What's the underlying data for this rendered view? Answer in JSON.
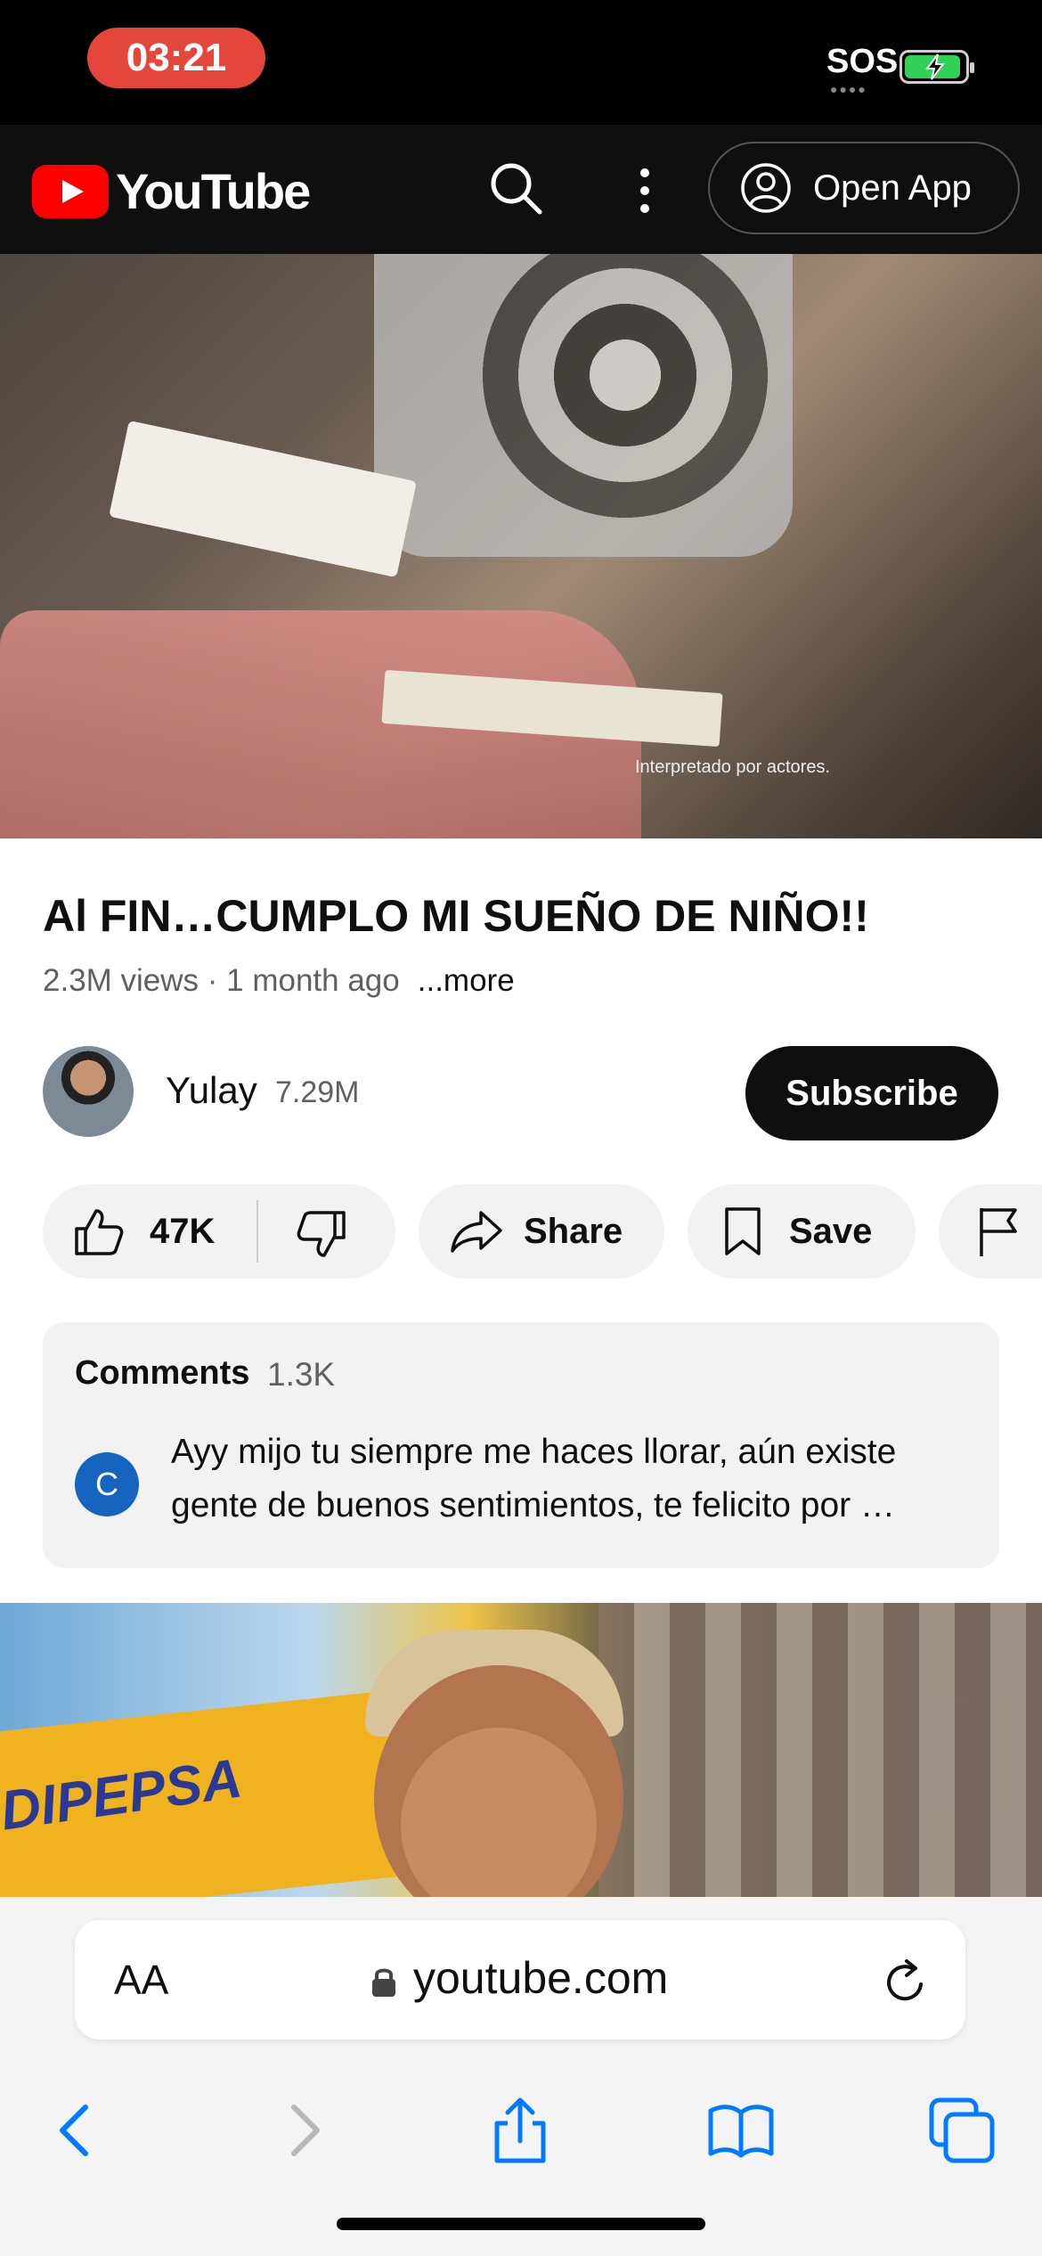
{
  "status_bar": {
    "time": "03:21",
    "sos": "SOS"
  },
  "youtube_header": {
    "logo_text": "YouTube",
    "open_app_label": "Open App"
  },
  "video": {
    "overlay_caption": "Interpretado por actores."
  },
  "details": {
    "title": "Al FIN…CUMPLO MI SUEÑO DE NIÑO!!",
    "meta": "2.3M views · 1 month ago",
    "more_label": "...more"
  },
  "channel": {
    "name": "Yulay",
    "subscribers": "7.29M",
    "subscribe_label": "Subscribe"
  },
  "actions": {
    "like_count": "47K",
    "share_label": "Share",
    "save_label": "Save"
  },
  "comments": {
    "heading": "Comments",
    "count": "1.3K",
    "top_comment_avatar_letter": "C",
    "top_comment_text": "Ayy mijo tu siempre me haces llorar, aún existe gente de buenos sentimientos, te felicito por …"
  },
  "next_video_thumbnail": {
    "sign_text": "DIPEPSA"
  },
  "safari": {
    "text_size_label": "AA",
    "url": "youtube.com"
  },
  "icons": {
    "status": [
      "battery-charging-icon"
    ],
    "header": [
      "youtube-logo-icon",
      "search-icon",
      "more-vert-icon",
      "account-circle-icon"
    ],
    "actions": [
      "thumbs-up-icon",
      "thumbs-down-icon",
      "share-arrow-icon",
      "bookmark-icon",
      "flag-icon"
    ],
    "safari": [
      "lock-icon",
      "reload-icon",
      "back-chevron-icon",
      "forward-chevron-icon",
      "share-icon",
      "bookmarks-icon",
      "tabs-icon"
    ]
  },
  "colors": {
    "youtube_red": "#ff0000",
    "safari_blue": "#007aff",
    "recording_pill": "#e5463b"
  }
}
